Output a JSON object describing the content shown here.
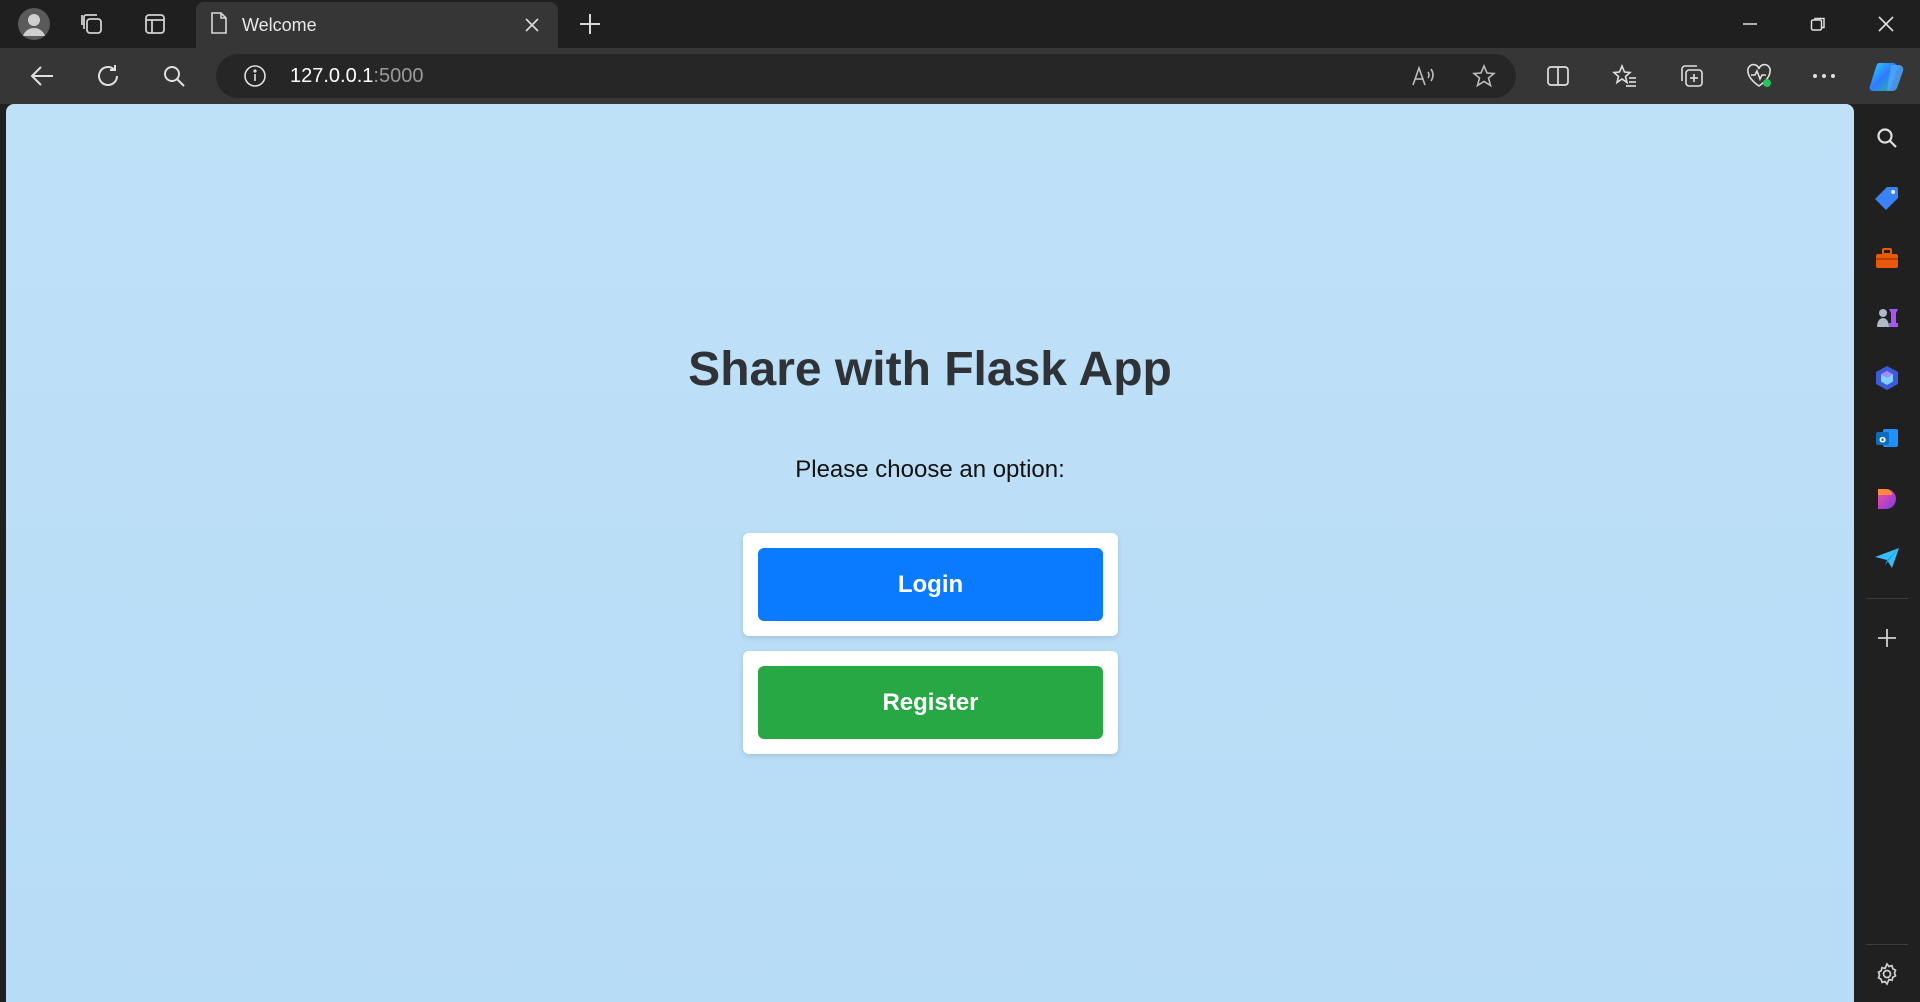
{
  "tab": {
    "title": "Welcome"
  },
  "address": {
    "host": "127.0.0.1",
    "port": ":5000"
  },
  "page": {
    "title": "Share with Flask App",
    "subtitle": "Please choose an option:",
    "login_label": "Login",
    "register_label": "Register"
  },
  "colors": {
    "login": "#0a7bff",
    "register": "#28a745",
    "background": "#bfe1f8"
  },
  "icons": {
    "toolbar": [
      "back-icon",
      "refresh-icon",
      "search-icon",
      "info-icon",
      "read-aloud-icon",
      "favorite-star-icon",
      "split-screen-icon",
      "favorites-icon",
      "collections-icon",
      "browser-essentials-icon",
      "more-icon",
      "copilot-icon"
    ],
    "sidebar": [
      "search-icon",
      "shopping-tag-icon",
      "toolbox-icon",
      "games-icon",
      "copilot-sidebar-icon",
      "outlook-icon",
      "designer-icon",
      "send-icon",
      "add-icon",
      "settings-icon"
    ]
  }
}
